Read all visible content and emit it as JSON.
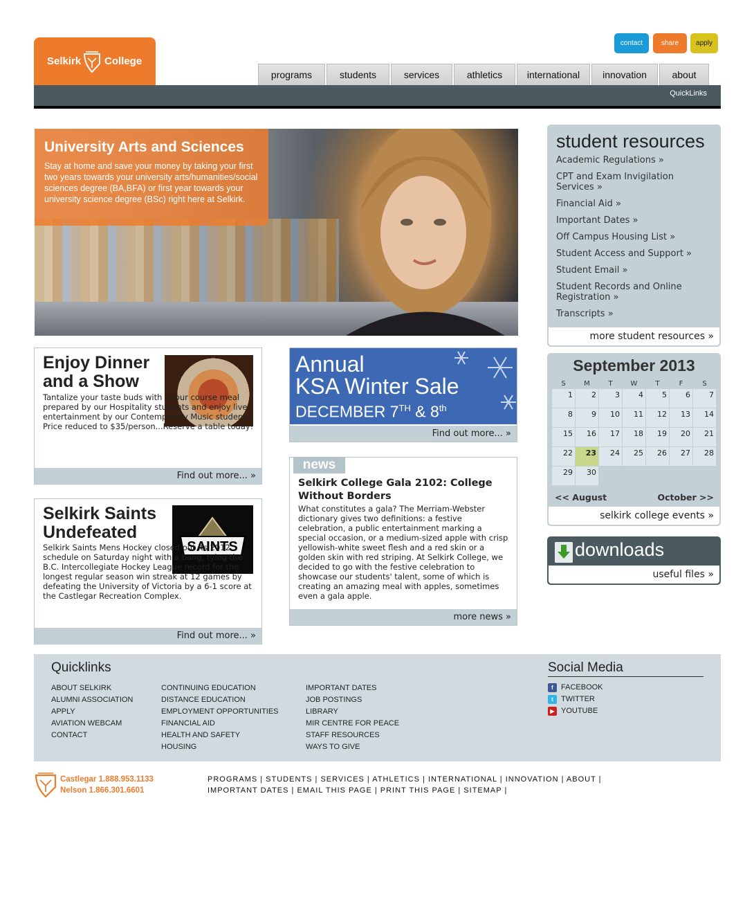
{
  "brand": {
    "left": "Selkirk",
    "right": "College",
    "orange": "#ee7b2c",
    "blue": "#1a9ad6",
    "gold": "#d8c21d",
    "slate": "#4a5a60",
    "panel": "#c3d1d6"
  },
  "top_buttons": {
    "contact": "contact",
    "share": "share",
    "apply": "apply"
  },
  "nav": [
    "programs",
    "students",
    "services",
    "athletics",
    "international",
    "innovation",
    "about"
  ],
  "quicklinks_bar": "QuickLinks",
  "hero": {
    "title": "University Arts and Sciences",
    "text": "Stay at home and save your money by taking your first two years towards your university arts/humanities/social sciences degree (BA,BFA) or first year towards your university science degree (BSc) right here at Selkirk."
  },
  "dinner": {
    "title": "Enjoy Dinner and a Show",
    "text": "Tantalize your taste buds with a four course meal prepared by our Hospitality students and enjoy live entertainment by our Contemporary Music students. Price reduced to $35/person...Reserve a table today!",
    "more": "Find out more... »"
  },
  "saints": {
    "title": "Selkirk Saints Undefeated",
    "logo_text": "SAINTS",
    "text": "Selkirk Saints Mens Hockey closed out its 2012 schedule on Saturday night with a bang, tying the B.C. Intercollegiate Hockey League record for the longest regular season win streak at 12 games by defeating the University of Victoria by a 6-1 score at the Castlegar Recreation Complex.",
    "more": "Find out more... »"
  },
  "ksa": {
    "line1": "Annual",
    "line2": "KSA Winter Sale",
    "line3_a": "DECEMBER 7",
    "line3_sup1": "TH",
    "line3_b": " & 8",
    "line3_sup2": "th",
    "more": "Find out more... »"
  },
  "news": {
    "tag": "news",
    "title": "Selkirk College Gala 2102: College Without Borders",
    "text": "What constitutes a gala? The Merriam-Webster dictionary gives two definitions: a festive celebration, a public entertainment marking a special occasion, or a medium-sized apple with crisp yellowish-white sweet flesh and a red skin or a golden skin with red striping. At Selkirk College, we decided to go with the festive celebration to showcase our students' talent, some of which is creating an amazing meal with apples, sometimes even a gala apple.",
    "more": "more news »"
  },
  "resources": {
    "title": "student resources",
    "items": [
      "Academic Regulations »",
      "CPT and Exam Invigilation Services »",
      "Financial Aid »",
      "Important Dates »",
      "Off Campus Housing List »",
      "Student Access and Support »",
      "Student Email »",
      "Student Records and Online Registration »",
      "Transcripts »"
    ],
    "more": "more student resources »"
  },
  "calendar": {
    "title": "September 2013",
    "dow": [
      "S",
      "M",
      "T",
      "W",
      "T",
      "F",
      "S"
    ],
    "days": [
      "1",
      "2",
      "3",
      "4",
      "5",
      "6",
      "7",
      "8",
      "9",
      "10",
      "11",
      "12",
      "13",
      "14",
      "15",
      "16",
      "17",
      "18",
      "19",
      "20",
      "21",
      "22",
      "23",
      "24",
      "25",
      "26",
      "27",
      "28",
      "29",
      "30"
    ],
    "today": "23",
    "prev": "<< August",
    "next": "October >>",
    "more": "selkirk college events »"
  },
  "downloads": {
    "title": "downloads",
    "more": "useful files »"
  },
  "footer": {
    "quicklinks_title": "Quicklinks",
    "col1": [
      "ABOUT SELKIRK",
      "ALUMNI ASSOCIATION",
      "APPLY",
      "AVIATION WEBCAM",
      "CONTACT"
    ],
    "col2": [
      "CONTINUING EDUCATION",
      "DISTANCE EDUCATION",
      "EMPLOYMENT OPPORTUNITIES",
      "FINANCIAL AID",
      "HEALTH AND SAFETY",
      "HOUSING"
    ],
    "col3": [
      "IMPORTANT DATES",
      "JOB POSTINGS",
      "LIBRARY",
      "MIR CENTRE FOR PEACE",
      "STAFF RESOURCES",
      "WAYS TO GIVE"
    ],
    "social_title": "Social Media",
    "social": [
      {
        "label": "FACEBOOK",
        "icon": "facebook-icon",
        "glyph": "f",
        "color": "#3b5998"
      },
      {
        "label": "TWITTER",
        "icon": "twitter-icon",
        "glyph": "t",
        "color": "#33b5e5"
      },
      {
        "label": "YOUTUBE",
        "icon": "youtube-icon",
        "glyph": "▶",
        "color": "#cc2020"
      }
    ]
  },
  "contact": {
    "castlegar": "Castlegar 1.888.953.1133",
    "nelson": "Nelson 1.866.301.6601"
  },
  "bottom_links": {
    "row1": [
      "PROGRAMS",
      "STUDENTS",
      "SERVICES",
      "ATHLETICS",
      "INTERNATIONAL",
      "INNOVATION",
      "ABOUT"
    ],
    "row2": [
      "IMPORTANT DATES",
      "EMAIL THIS PAGE",
      "PRINT THIS PAGE",
      "SITEMAP"
    ]
  }
}
